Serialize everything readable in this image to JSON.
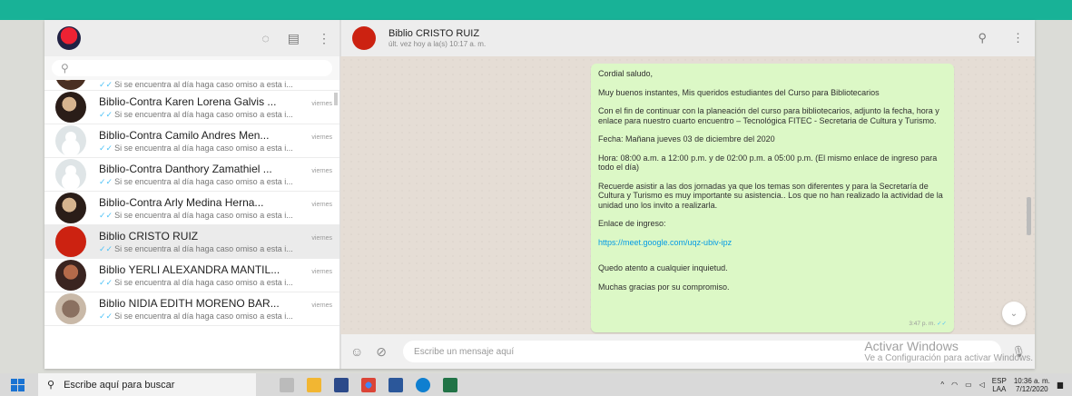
{
  "sidebar": {
    "search_placeholder": "",
    "chats": [
      {
        "name": "",
        "date": "",
        "message": "Si se encuentra al día haga caso omiso a esta i...",
        "avatar": "photo-avatar",
        "partial": true
      },
      {
        "name": "Biblio-Contra Karen Lorena Galvis ...",
        "date": "viernes",
        "message": "Si se encuentra al día haga caso omiso a esta i...",
        "avatar": "photo-avatar"
      },
      {
        "name": "Biblio-Contra Camilo Andres Men...",
        "date": "viernes",
        "message": "Si se encuentra al día haga caso omiso a esta i...",
        "avatar": "default-avatar"
      },
      {
        "name": "Biblio-Contra Danthory Zamathiel ...",
        "date": "viernes",
        "message": "Si se encuentra al día haga caso omiso a esta i...",
        "avatar": "default-avatar"
      },
      {
        "name": "Biblio-Contra Arly  Medina Herna...",
        "date": "viernes",
        "message": "Si se encuentra al día haga caso omiso a esta i...",
        "avatar": "photo-avatar"
      },
      {
        "name": "Biblio CRISTO RUIZ",
        "date": "viernes",
        "message": "Si se encuentra al día haga caso omiso a esta i...",
        "avatar": "red-avatar",
        "active": true
      },
      {
        "name": "Biblio YERLI ALEXANDRA MANTIL...",
        "date": "viernes",
        "message": "Si se encuentra al día haga caso omiso a esta i...",
        "avatar": "photo-avatar"
      },
      {
        "name": "Biblio NIDIA EDITH MORENO BAR...",
        "date": "viernes",
        "message": "Si se encuentra al día haga caso omiso a esta i...",
        "avatar": "photo-avatar"
      }
    ]
  },
  "main": {
    "contact_name": "Biblio CRISTO RUIZ",
    "contact_status": "últ. vez hoy a la(s) 10:17 a. m.",
    "message": {
      "paragraphs": [
        "Cordial saludo,",
        "Muy buenos instantes, Mis queridos estudiantes del Curso para Bibliotecarios",
        "Con el fin de continuar con la planeación del curso para bibliotecarios, adjunto la fecha, hora y enlace para nuestro cuarto encuentro – Tecnológica FITEC - Secretaria de Cultura y Turismo.",
        "Fecha: Mañana jueves 03 de diciembre del 2020",
        "Hora:  08:00 a.m. a 12:00 p.m. y de 02:00 p.m. a 05:00 p.m. (El mismo enlace de ingreso para todo el día)",
        "Recuerde asistir a las dos jornadas ya que los temas son diferentes y para la Secretaría de Cultura y Turismo es muy importante su asistencia.. Los que no han realizado la actividad de la unidad uno los invito a realizarla."
      ],
      "link_label": "Enlace de ingreso:",
      "link": "https://meet.google.com/uqz-ubiv-ipz",
      "closing1": "Quedo atento a cualquier inquietud.",
      "closing2": "Muchas gracias por su compromiso.",
      "time": "3:47 p. m."
    },
    "composer_placeholder": "Escribe un mensaje aquí"
  },
  "watermark": {
    "title": "Activar Windows",
    "subtitle": "Ve a Configuración para activar Windows."
  },
  "taskbar": {
    "search_text": "Escribe aquí para buscar",
    "language": "ESP",
    "language_sub": "LAA",
    "time": "10:36 a. m.",
    "date": "7/12/2020"
  },
  "colors": {
    "accent": "#18b297",
    "bubble": "#dcf8c6",
    "link": "#039be5"
  }
}
